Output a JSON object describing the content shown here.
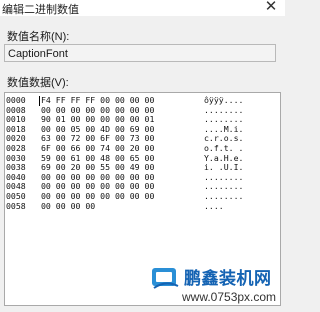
{
  "window": {
    "title": "编辑二进制数值",
    "close_glyph": "✕"
  },
  "value_name": {
    "label": "数值名称(N):",
    "value": "CaptionFont"
  },
  "value_data": {
    "label": "数值数据(V):",
    "rows": [
      {
        "offset": "0000",
        "bytes": "F4 FF FF FF 00 00 00 00",
        "ascii": "ôÿÿÿ...."
      },
      {
        "offset": "0008",
        "bytes": "00 00 00 00 00 00 00 00",
        "ascii": "........"
      },
      {
        "offset": "0010",
        "bytes": "90 01 00 00 00 00 00 01",
        "ascii": "........"
      },
      {
        "offset": "0018",
        "bytes": "00 00 05 00 4D 00 69 00",
        "ascii": "....M.i."
      },
      {
        "offset": "0020",
        "bytes": "63 00 72 00 6F 00 73 00",
        "ascii": "c.r.o.s."
      },
      {
        "offset": "0028",
        "bytes": "6F 00 66 00 74 00 20 00",
        "ascii": "o.f.t. ."
      },
      {
        "offset": "0030",
        "bytes": "59 00 61 00 48 00 65 00",
        "ascii": "Y.a.H.e."
      },
      {
        "offset": "0038",
        "bytes": "69 00 20 00 55 00 49 00",
        "ascii": "i. .U.I."
      },
      {
        "offset": "0040",
        "bytes": "00 00 00 00 00 00 00 00",
        "ascii": "........"
      },
      {
        "offset": "0048",
        "bytes": "00 00 00 00 00 00 00 00",
        "ascii": "........"
      },
      {
        "offset": "0050",
        "bytes": "00 00 00 00 00 00 00 00",
        "ascii": "........"
      },
      {
        "offset": "0058",
        "bytes": "00 00 00 00",
        "ascii": "...."
      }
    ]
  },
  "watermark": {
    "title": "鹏鑫装机网",
    "url": "www.0753px.com"
  }
}
